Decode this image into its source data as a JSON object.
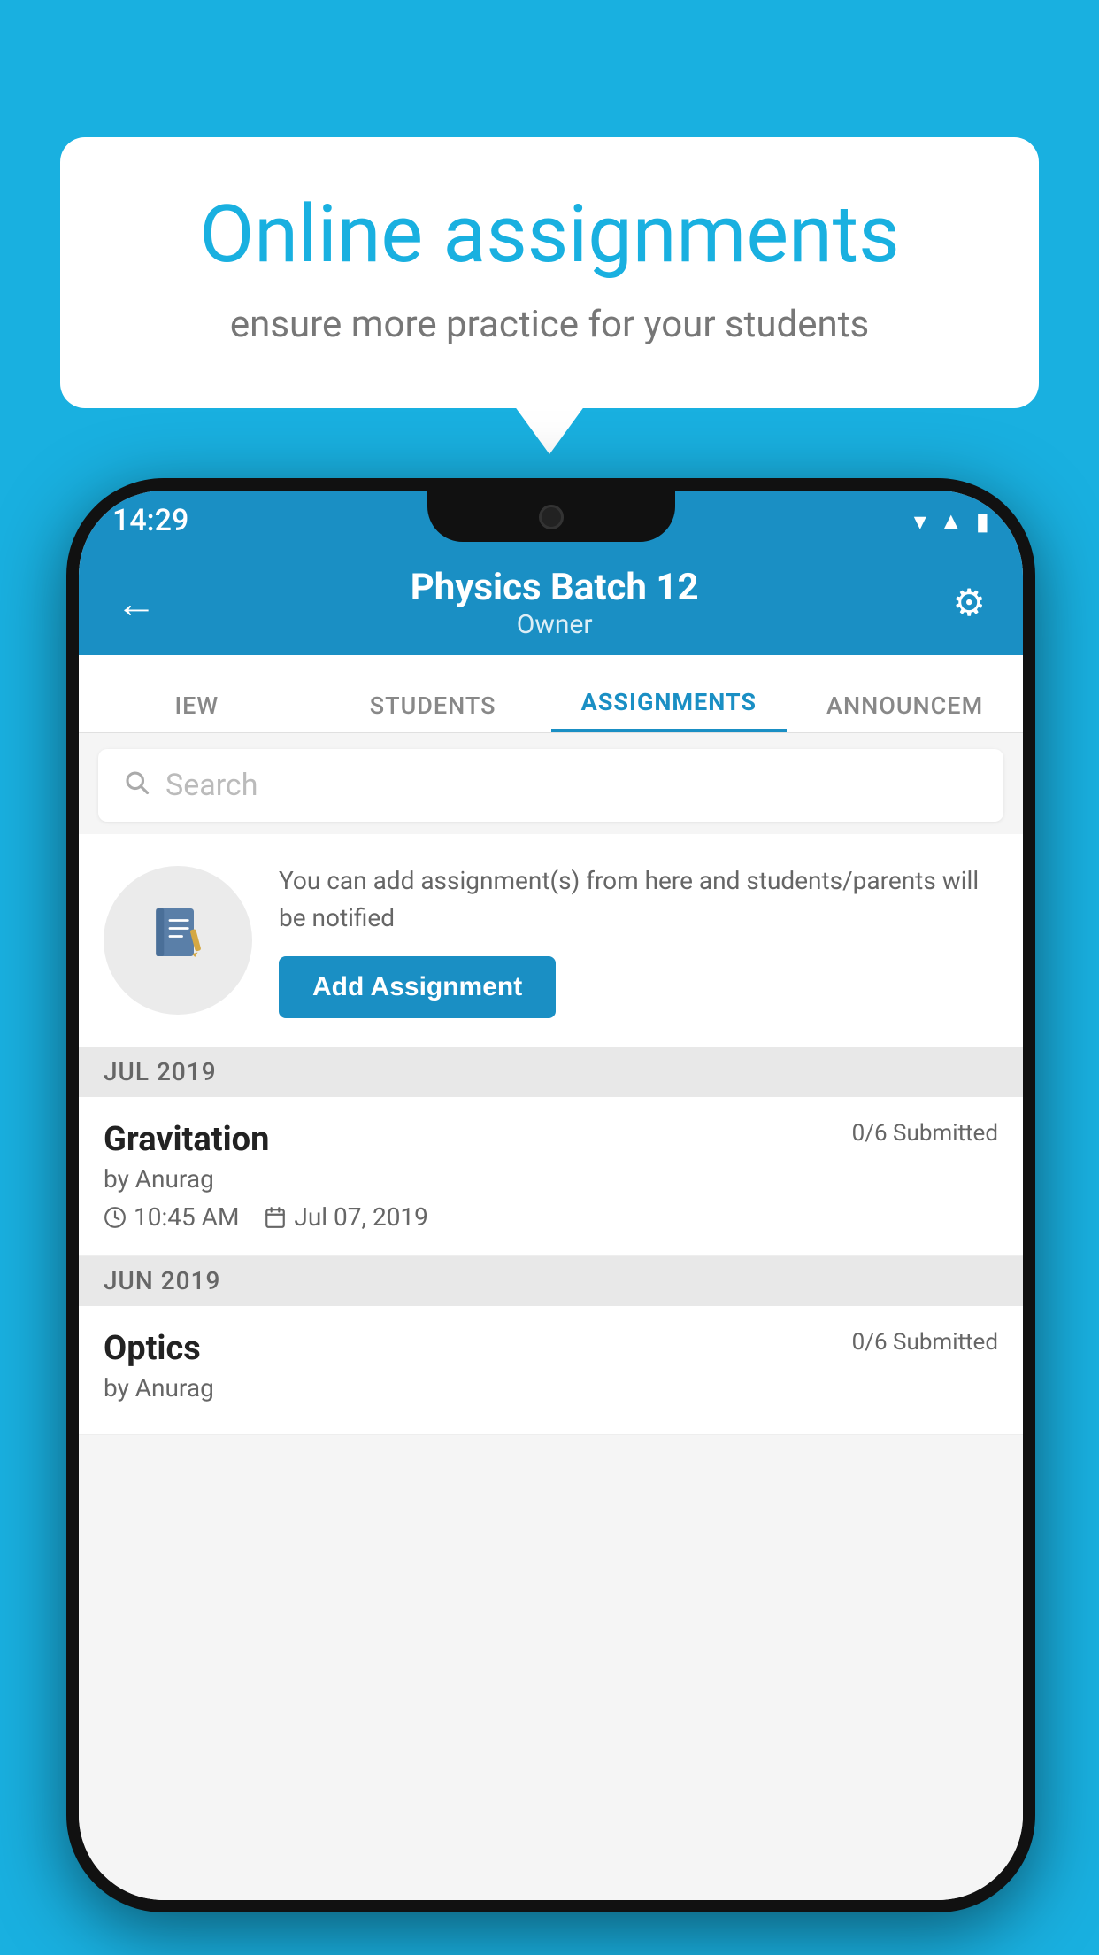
{
  "background_color": "#19b0e0",
  "promo": {
    "title": "Online assignments",
    "subtitle": "ensure more practice for your students"
  },
  "status_bar": {
    "time": "14:29"
  },
  "app_bar": {
    "title": "Physics Batch 12",
    "subtitle": "Owner",
    "back_label": "←",
    "settings_label": "⚙"
  },
  "tabs": [
    {
      "label": "IEW",
      "active": false
    },
    {
      "label": "STUDENTS",
      "active": false
    },
    {
      "label": "ASSIGNMENTS",
      "active": true
    },
    {
      "label": "ANNOUNCEM",
      "active": false
    }
  ],
  "search": {
    "placeholder": "Search"
  },
  "add_assignment": {
    "description": "You can add assignment(s) from here and students/parents will be notified",
    "button_label": "Add Assignment"
  },
  "sections": [
    {
      "header": "JUL 2019",
      "items": [
        {
          "title": "Gravitation",
          "status": "0/6 Submitted",
          "author": "by Anurag",
          "time": "10:45 AM",
          "date": "Jul 07, 2019"
        }
      ]
    },
    {
      "header": "JUN 2019",
      "items": [
        {
          "title": "Optics",
          "status": "0/6 Submitted",
          "author": "by Anurag",
          "time": "",
          "date": ""
        }
      ]
    }
  ]
}
